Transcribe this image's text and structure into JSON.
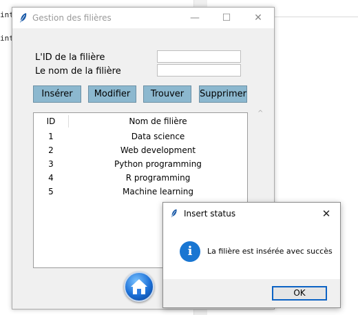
{
  "background": {
    "code_lines": [
      "int",
      "int"
    ]
  },
  "window": {
    "title": "Gestion des filières",
    "min_glyph": "—",
    "max_glyph": "☐",
    "close_glyph": "✕",
    "form": {
      "id_label": "L'ID de la filière",
      "name_label": "Le nom de la filière",
      "id_value": "",
      "name_value": ""
    },
    "buttons": {
      "insert": "Insérer",
      "modify": "Modifier",
      "find": "Trouver",
      "delete": "Supprimer"
    },
    "table": {
      "columns": [
        "ID",
        "Nom de filière"
      ],
      "rows": [
        {
          "id": "1",
          "name": "Data science"
        },
        {
          "id": "2",
          "name": "Web development"
        },
        {
          "id": "3",
          "name": "Python programming"
        },
        {
          "id": "4",
          "name": "R programming"
        },
        {
          "id": "5",
          "name": "Machine learning"
        }
      ]
    },
    "scroll_up_glyph": "^"
  },
  "dialog": {
    "title": "Insert status",
    "close_glyph": "✕",
    "info_glyph": "i",
    "message": "La filière est insérée avec succès",
    "ok_label": "OK"
  },
  "colors": {
    "button_bg": "#8cb8cf",
    "info_icon": "#1976d2",
    "ok_border": "#0b62c4"
  }
}
